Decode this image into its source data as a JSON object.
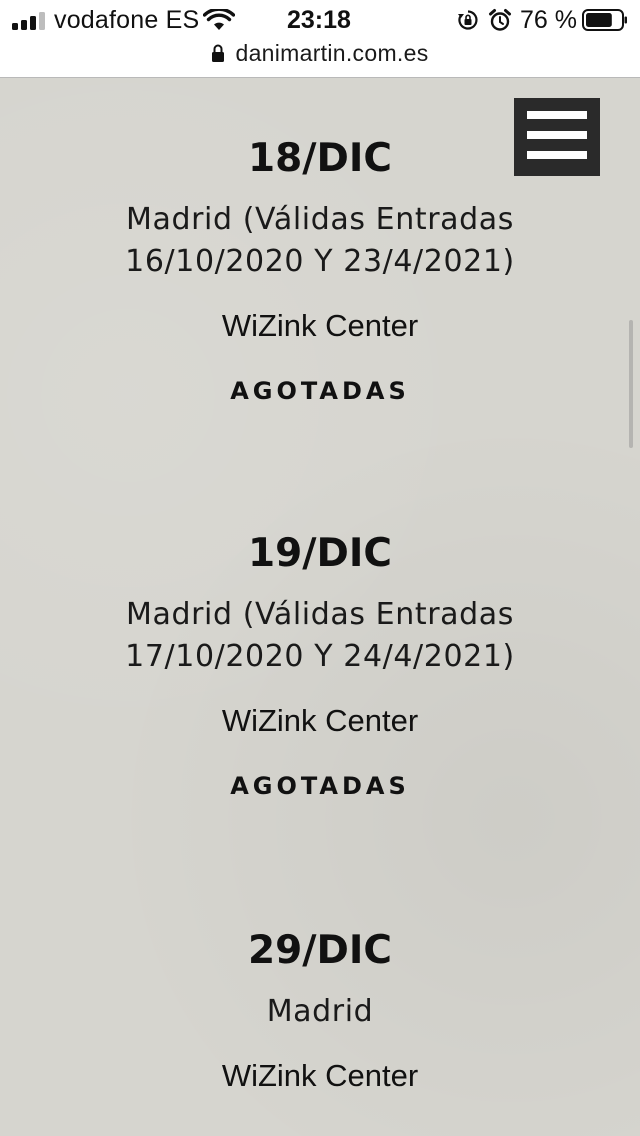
{
  "status_bar": {
    "carrier": "vodafone ES",
    "time": "23:18",
    "battery_percent": "76 %",
    "battery_level": 0.76,
    "icons": [
      "signal-icon",
      "wifi-icon",
      "rotation-lock-icon",
      "alarm-icon",
      "battery-icon"
    ]
  },
  "browser": {
    "url": "danimartin.com.es",
    "lock_icon": "padlock-icon"
  },
  "header": {
    "menu_icon": "hamburger-menu-icon"
  },
  "concerts": [
    {
      "date": "18/DIC",
      "city": "Madrid (Válidas Entradas 16/10/2020 Y 23/4/2021)",
      "venue": "WiZink Center",
      "status": "AGOTADAS"
    },
    {
      "date": "19/DIC",
      "city": "Madrid (Válidas Entradas 17/10/2020 Y 24/4/2021)",
      "venue": "WiZink Center",
      "status": "AGOTADAS"
    },
    {
      "date": "29/DIC",
      "city": "Madrid",
      "venue": "WiZink Center"
    }
  ],
  "colors": {
    "page_background": "#d6d5cf",
    "menu_button": "#2a2a2a",
    "text": "#111111"
  }
}
